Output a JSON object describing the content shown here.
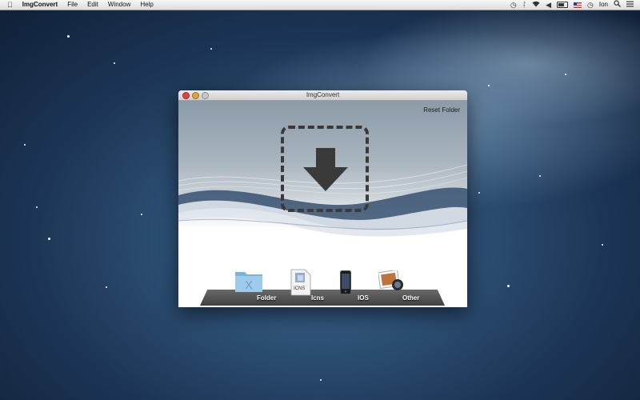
{
  "menubar": {
    "app_name": "ImgConvert",
    "menus": [
      "File",
      "Edit",
      "Window",
      "Help"
    ],
    "user": "Ion"
  },
  "window": {
    "title": "ImgConvert",
    "reset_folder_label": "Reset Folder"
  },
  "dock": {
    "items": [
      {
        "label": "Folder",
        "icon": "folder-icon"
      },
      {
        "label": "Icns",
        "icon": "icns-file-icon",
        "icon_text": "ICNS"
      },
      {
        "label": "IOS",
        "icon": "iphone-icon"
      },
      {
        "label": "Other",
        "icon": "photo-icon"
      }
    ]
  },
  "colors": {
    "desktop": "#1c3555",
    "window_close": "#e0443e",
    "window_min": "#dea236",
    "shelf": "#4a4a4a"
  }
}
